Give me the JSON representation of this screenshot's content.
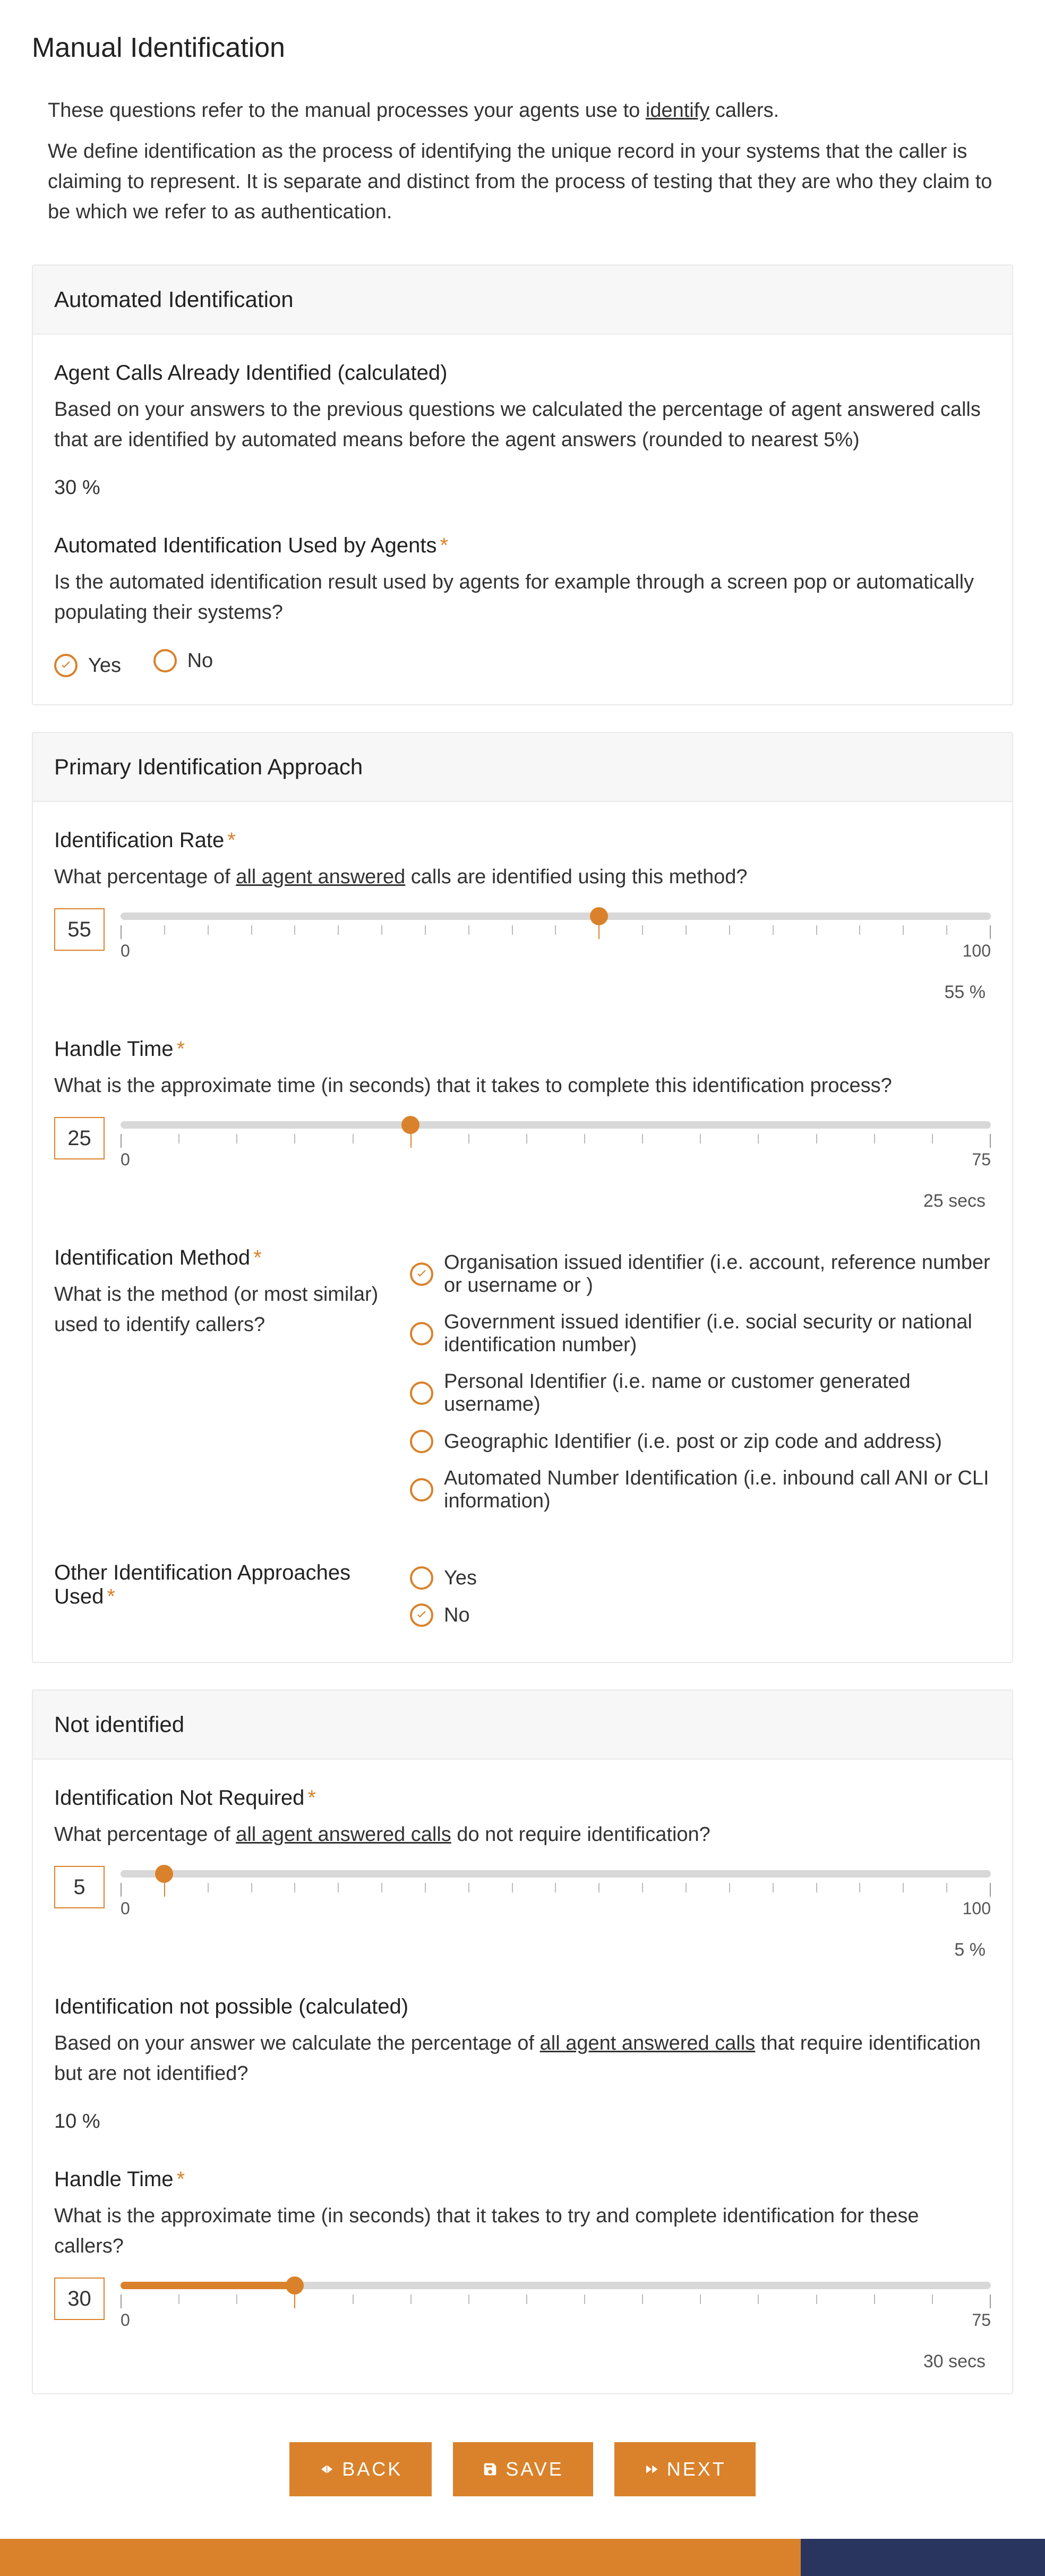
{
  "page": {
    "title": "Manual Identification",
    "intro1_a": "These questions refer to the manual processes your agents use to ",
    "intro1_u": "identify",
    "intro1_b": " callers.",
    "intro2": "We define identification as the process of identifying the unique record in your systems that the caller is claiming to represent. It is separate and distinct from the process of testing that they are who they claim to be which we refer to as authentication."
  },
  "common": {
    "yes": "Yes",
    "no": "No"
  },
  "sections": {
    "automated": {
      "header": "Automated Identification",
      "calc": {
        "label": "Agent Calls Already Identified (calculated)",
        "desc": "Based on your answers to the previous questions we calculated the percentage of agent answered calls that are identified by automated means before the agent answers (rounded to nearest 5%)",
        "value": "30 %"
      },
      "used": {
        "label": "Automated Identification Used by Agents",
        "desc": "Is the automated identification result used by agents for example through a screen pop or automatically populating their systems?",
        "selected": "yes"
      }
    },
    "primary": {
      "header": "Primary Identification Approach",
      "rate": {
        "label": "Identification Rate",
        "desc_a": "What percentage of ",
        "desc_u": "all agent answered",
        "desc_b": " calls are identified using this method?",
        "value": 55,
        "min": 0,
        "max": 100,
        "readout": "55 %"
      },
      "handle": {
        "label": "Handle Time",
        "desc": "What is the approximate time (in seconds) that it takes to complete this identification process?",
        "value": 25,
        "min": 0,
        "max": 75,
        "readout": "25 secs"
      },
      "method": {
        "label": "Identification Method",
        "desc": "What is the method (or most similar) used to identify callers?",
        "selected": 0,
        "options": [
          "Organisation issued identifier (i.e. account, reference number or username or )",
          "Government issued identifier (i.e. social security or national identification number)",
          "Personal Identifier (i.e. name or customer generated username)",
          "Geographic Identifier (i.e. post or zip code and address)",
          "Automated Number Identification (i.e. inbound call ANI or CLI information)"
        ]
      },
      "other": {
        "label": "Other Identification Approaches Used",
        "selected": "no"
      }
    },
    "notid": {
      "header": "Not identified",
      "notreq": {
        "label": "Identification Not Required",
        "desc_a": "What percentage of ",
        "desc_u": "all agent answered calls",
        "desc_b": " do not require identification?",
        "value": 5,
        "min": 0,
        "max": 100,
        "readout": "5 %"
      },
      "notpos": {
        "label": "Identification not possible (calculated)",
        "desc_a": "Based on your answer we calculate the percentage of ",
        "desc_u": "all agent answered calls",
        "desc_b": " that require identification but are not identified?",
        "value": "10 %"
      },
      "handle": {
        "label": "Handle Time",
        "desc": "What is the approximate time (in seconds) that it takes to try and complete identification for these callers?",
        "value": 30,
        "min": 0,
        "mid": 15,
        "max": 75,
        "readout": "30 secs"
      }
    }
  },
  "buttons": {
    "back": "BACK",
    "save": "SAVE",
    "next": "NEXT"
  }
}
